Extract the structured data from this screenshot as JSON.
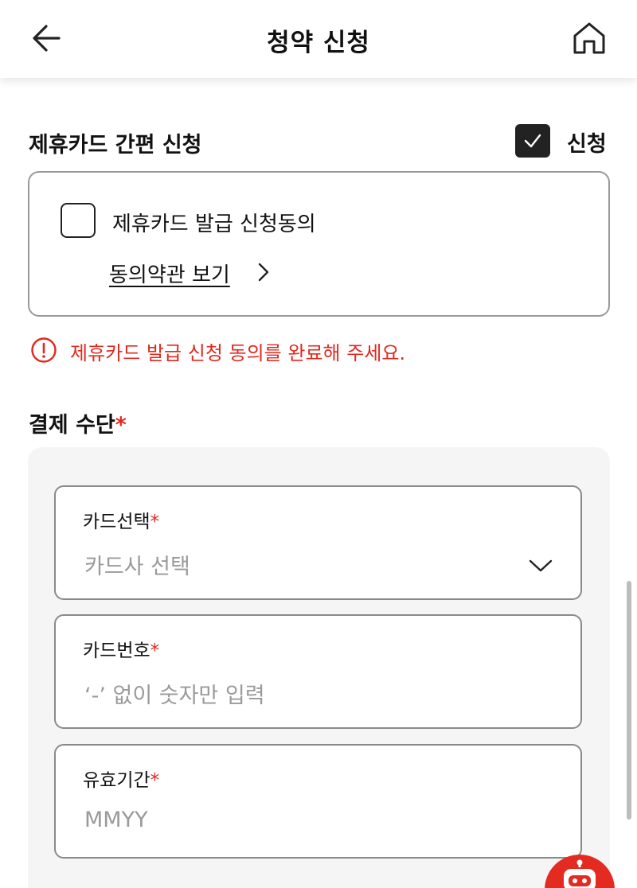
{
  "header": {
    "title": "청약 신청",
    "back_icon": "back-arrow-icon",
    "home_icon": "home-icon"
  },
  "partner_card": {
    "section_title": "제휴카드 간편 신청",
    "apply_label": "신청",
    "apply_checked": true,
    "agree_label": "제휴카드 발급 신청동의",
    "agree_checked": false,
    "terms_link": "동의약관 보기",
    "error_message": "제휴카드 발급 신청 동의를 완료해 주세요."
  },
  "payment": {
    "section_title": "결제 수단",
    "required_mark": "*",
    "fields": [
      {
        "label": "카드선택",
        "required": "*",
        "placeholder": "카드사 선택",
        "type": "select"
      },
      {
        "label": "카드번호",
        "required": "*",
        "placeholder": "‘-’ 없이 숫자만 입력",
        "type": "input"
      },
      {
        "label": "유효기간",
        "required": "*",
        "placeholder": "MMYY",
        "type": "input"
      }
    ]
  },
  "colors": {
    "accent_red": "#e0291f",
    "panel_bg": "#f5f5f5",
    "border": "#8a8a8a",
    "placeholder": "#9a9a9a"
  },
  "icons": [
    "back-arrow-icon",
    "home-icon",
    "checkmark-icon",
    "chevron-right-icon",
    "error-circle-icon",
    "chevron-down-icon",
    "chatbot-icon"
  ]
}
